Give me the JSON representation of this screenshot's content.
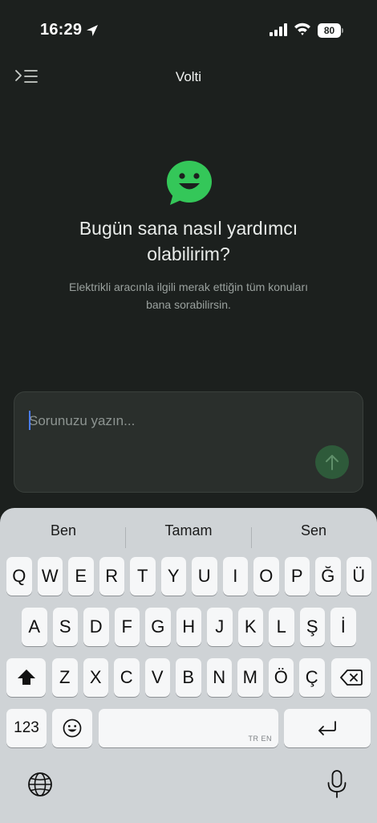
{
  "status_bar": {
    "time": "16:29",
    "battery": "80"
  },
  "header": {
    "title": "Volti"
  },
  "hero": {
    "title_line1": "Bugün sana nasıl yardımcı",
    "title_line2": "olabilirim?",
    "subtitle_line1": "Elektrikli aracınla ilgili merak ettiğin tüm konuları",
    "subtitle_line2": "bana sorabilirsin."
  },
  "input": {
    "placeholder": "Sorunuzu yazın..."
  },
  "colors": {
    "accent": "#34c759",
    "send_bg": "#2e5a3a",
    "background": "#1c201e"
  },
  "keyboard": {
    "suggestions": [
      "Ben",
      "Tamam",
      "Sen"
    ],
    "row1": [
      "Q",
      "W",
      "E",
      "R",
      "T",
      "Y",
      "U",
      "I",
      "O",
      "P",
      "Ğ",
      "Ü"
    ],
    "row2": [
      "A",
      "S",
      "D",
      "F",
      "G",
      "H",
      "J",
      "K",
      "L",
      "Ş",
      "İ"
    ],
    "row3": [
      "Z",
      "X",
      "C",
      "V",
      "B",
      "N",
      "M",
      "Ö",
      "Ç"
    ],
    "numbers_label": "123",
    "space_lang": "TR EN"
  }
}
